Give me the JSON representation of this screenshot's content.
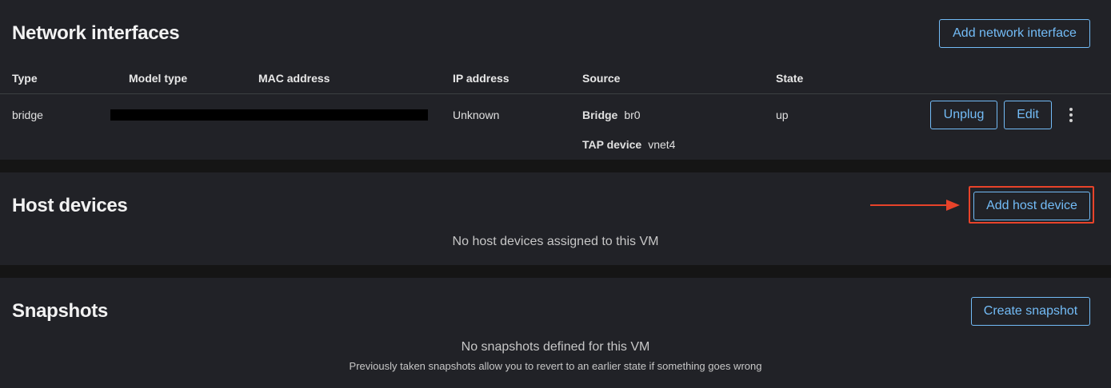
{
  "network": {
    "title": "Network interfaces",
    "add_button": "Add network interface",
    "columns": [
      "Type",
      "Model type",
      "MAC address",
      "IP address",
      "Source",
      "State"
    ],
    "row": {
      "type": "bridge",
      "ip": "Unknown",
      "source_bridge_label": "Bridge",
      "source_bridge_value": "br0",
      "source_tap_label": "TAP device",
      "source_tap_value": "vnet4",
      "state": "up",
      "unplug_label": "Unplug",
      "edit_label": "Edit"
    }
  },
  "host_devices": {
    "title": "Host devices",
    "add_button": "Add host device",
    "empty_text": "No host devices assigned to this VM"
  },
  "snapshots": {
    "title": "Snapshots",
    "create_button": "Create snapshot",
    "empty_text": "No snapshots defined for this VM",
    "empty_subtext": "Previously taken snapshots allow you to revert to an earlier state if something goes wrong"
  },
  "colors": {
    "background": "#151515",
    "card": "#212227",
    "accent": "#73bcf7",
    "annotation": "#e8432a"
  }
}
